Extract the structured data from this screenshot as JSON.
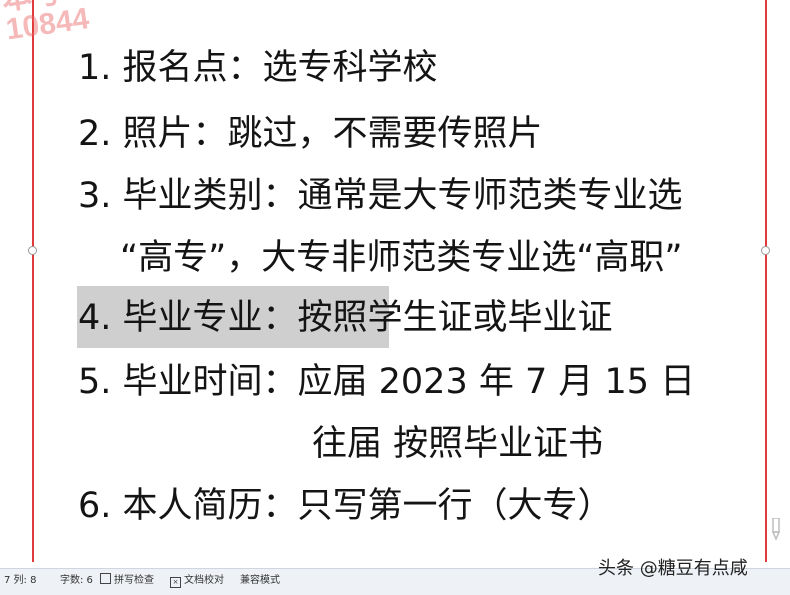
{
  "watermark": {
    "line1": "本号",
    "line2": "10844"
  },
  "document": {
    "lines": [
      "1. 报名点：选专科学校",
      "2. 照片：跳过，不需要传照片",
      "3. 毕业类别：通常是大专师范类专业选",
      "“高专”，大专非师范类专业选“高职”",
      "4. 毕业专业：按照学生证或毕业证",
      "5. 毕业时间：应届 2023 年 7 月 15 日",
      "往届 按照毕业证书",
      "6. 本人简历：只写第一行（大专）"
    ]
  },
  "statusbar": {
    "position": "7  列: 8",
    "word_count": "字数: 6",
    "spell_check": "拼写检查",
    "doc_proof": "文档校对",
    "compat_mode": "兼容模式"
  },
  "credit": "头条 @糖豆有点咸",
  "colors": {
    "page_border": "#e03a3a",
    "highlight": "#cfcfcf",
    "watermark": "#eb6464"
  },
  "icons": {
    "spell_check": "checkbox-icon",
    "doc_proof": "checkbox-x-icon",
    "pen": "pen-icon"
  }
}
